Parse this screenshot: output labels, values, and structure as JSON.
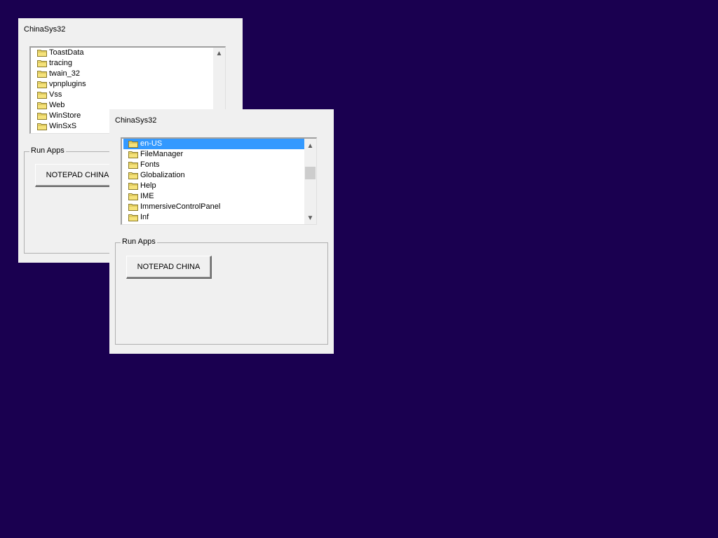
{
  "window1": {
    "title": "ChinaSys32",
    "folders": [
      "ToastData",
      "tracing",
      "twain_32",
      "vpnplugins",
      "Vss",
      "Web",
      "WinStore",
      "WinSxS"
    ],
    "group_label": "Run Apps",
    "button_label": "NOTEPAD CHINA"
  },
  "window2": {
    "title": "ChinaSys32",
    "folders": [
      "en-US",
      "FileManager",
      "Fonts",
      "Globalization",
      "Help",
      "IME",
      "ImmersiveControlPanel",
      "Inf"
    ],
    "selected_folder": "en-US",
    "group_label": "Run Apps",
    "button_label": "NOTEPAD CHINA"
  },
  "colors": {
    "desktop": "#1a0050",
    "window_bg": "#f0f0f0",
    "selection": "#3399ff",
    "folder_fill": "#f5e27a"
  },
  "icons": {
    "folder": "folder-icon",
    "scroll_up": "scroll-up-arrow-icon",
    "scroll_down": "scroll-down-arrow-icon"
  }
}
